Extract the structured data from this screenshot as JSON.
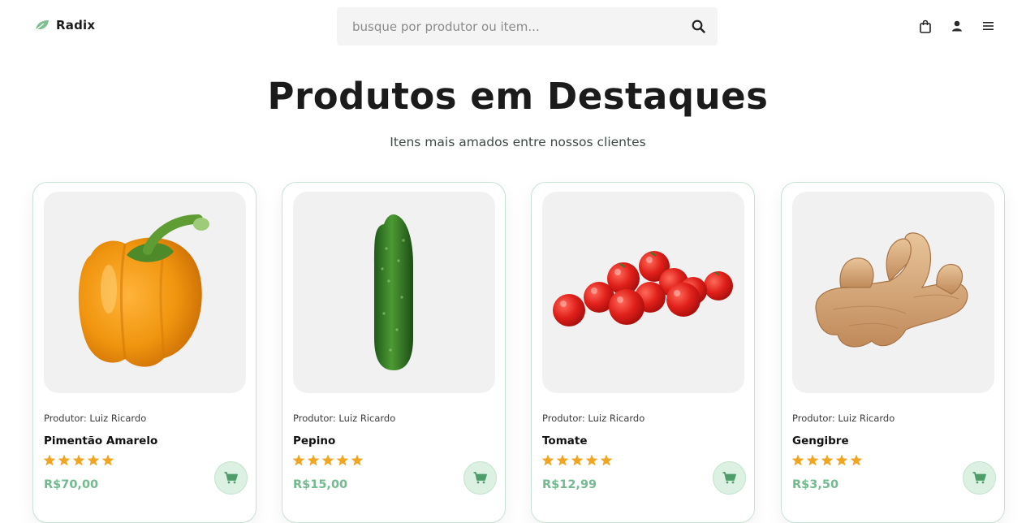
{
  "header": {
    "brand": "Radix",
    "search_placeholder": "busque por produtor ou item..."
  },
  "section": {
    "title": "Produtos em Destaques",
    "subtitle": "Itens mais amados entre nossos clientes"
  },
  "products": [
    {
      "producer": "Produtor: Luiz Ricardo",
      "name": "Pimentão Amarelo",
      "price": "R$70,00",
      "rating": 5
    },
    {
      "producer": "Produtor: Luiz Ricardo",
      "name": "Pepino",
      "price": "R$15,00",
      "rating": 5
    },
    {
      "producer": "Produtor: Luiz Ricardo",
      "name": "Tomate",
      "price": "R$12,99",
      "rating": 5
    },
    {
      "producer": "Produtor: Luiz Ricardo",
      "name": "Gengibre",
      "price": "R$3,50",
      "rating": 5
    }
  ],
  "icons": {
    "logo": "leaf-icon",
    "search": "search-icon",
    "bag": "shopping-bag-icon",
    "user": "user-icon",
    "menu": "menu-icon",
    "cart": "cart-icon",
    "star": "star-icon"
  },
  "colors": {
    "accent_green": "#74ba8f",
    "star_orange": "#f0a523",
    "card_border": "#c8e3d3",
    "cart_bg": "#ddf1e3"
  }
}
